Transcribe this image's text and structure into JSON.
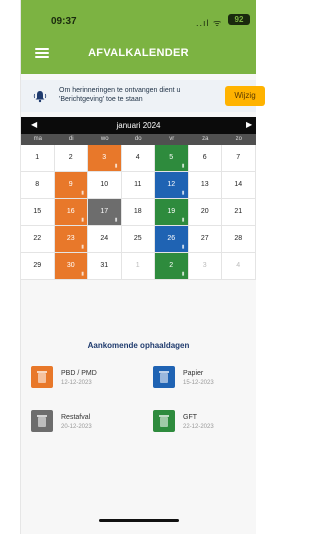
{
  "status": {
    "time": "09:37",
    "signal": "..ıl ᯤ",
    "battery": "92"
  },
  "header": {
    "title": "AFVALKALENDER"
  },
  "notice": {
    "text": "Om herinneringen te ontvangen dient u 'Berichtgeving' toe te staan",
    "button": "Wijzig"
  },
  "calendar": {
    "month": "januari 2024",
    "prev": "◀",
    "next": "▶",
    "weekdays": [
      "ma",
      "di",
      "wo",
      "do",
      "vr",
      "za",
      "zo"
    ],
    "days": [
      {
        "d": "1"
      },
      {
        "d": "2"
      },
      {
        "d": "3",
        "c": "orange"
      },
      {
        "d": "4"
      },
      {
        "d": "5",
        "c": "green"
      },
      {
        "d": "6"
      },
      {
        "d": "7"
      },
      {
        "d": "8"
      },
      {
        "d": "9",
        "c": "orange"
      },
      {
        "d": "10"
      },
      {
        "d": "11"
      },
      {
        "d": "12",
        "c": "blue"
      },
      {
        "d": "13"
      },
      {
        "d": "14"
      },
      {
        "d": "15"
      },
      {
        "d": "16",
        "c": "orange"
      },
      {
        "d": "17",
        "c": "grey"
      },
      {
        "d": "18"
      },
      {
        "d": "19",
        "c": "green"
      },
      {
        "d": "20"
      },
      {
        "d": "21"
      },
      {
        "d": "22"
      },
      {
        "d": "23",
        "c": "orange"
      },
      {
        "d": "24"
      },
      {
        "d": "25"
      },
      {
        "d": "26",
        "c": "blue"
      },
      {
        "d": "27"
      },
      {
        "d": "28"
      },
      {
        "d": "29"
      },
      {
        "d": "30",
        "c": "orange"
      },
      {
        "d": "31"
      },
      {
        "d": "1",
        "m": true
      },
      {
        "d": "2",
        "c": "green"
      },
      {
        "d": "3",
        "m": true
      },
      {
        "d": "4",
        "m": true
      }
    ]
  },
  "upcoming": {
    "title": "Aankomende ophaaldagen",
    "items": [
      {
        "name": "PBD / PMD",
        "date": "12-12-2023",
        "color": "#e8782a",
        "icon": "bin-icon"
      },
      {
        "name": "Papier",
        "date": "15-12-2023",
        "color": "#1f63b3",
        "icon": "bin-icon"
      },
      {
        "name": "Restafval",
        "date": "20-12-2023",
        "color": "#6d6d6d",
        "icon": "bin-icon"
      },
      {
        "name": "GFT",
        "date": "22-12-2023",
        "color": "#2e8b3d",
        "icon": "bin-icon"
      }
    ]
  }
}
